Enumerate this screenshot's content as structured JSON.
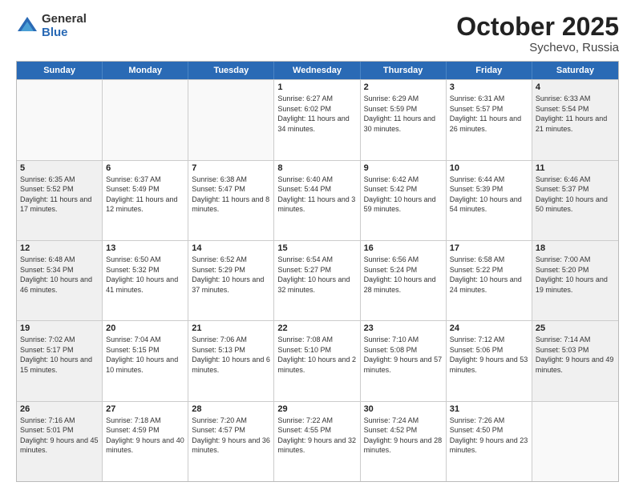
{
  "logo": {
    "general": "General",
    "blue": "Blue"
  },
  "title": {
    "month": "October 2025",
    "location": "Sychevo, Russia"
  },
  "days": [
    "Sunday",
    "Monday",
    "Tuesday",
    "Wednesday",
    "Thursday",
    "Friday",
    "Saturday"
  ],
  "weeks": [
    [
      {
        "day": "",
        "empty": true
      },
      {
        "day": "",
        "empty": true
      },
      {
        "day": "",
        "empty": true
      },
      {
        "day": "1",
        "sunrise": "6:27 AM",
        "sunset": "6:02 PM",
        "daylight": "11 hours and 34 minutes."
      },
      {
        "day": "2",
        "sunrise": "6:29 AM",
        "sunset": "5:59 PM",
        "daylight": "11 hours and 30 minutes."
      },
      {
        "day": "3",
        "sunrise": "6:31 AM",
        "sunset": "5:57 PM",
        "daylight": "11 hours and 26 minutes."
      },
      {
        "day": "4",
        "sunrise": "6:33 AM",
        "sunset": "5:54 PM",
        "daylight": "11 hours and 21 minutes."
      }
    ],
    [
      {
        "day": "5",
        "sunrise": "6:35 AM",
        "sunset": "5:52 PM",
        "daylight": "11 hours and 17 minutes."
      },
      {
        "day": "6",
        "sunrise": "6:37 AM",
        "sunset": "5:49 PM",
        "daylight": "11 hours and 12 minutes."
      },
      {
        "day": "7",
        "sunrise": "6:38 AM",
        "sunset": "5:47 PM",
        "daylight": "11 hours and 8 minutes."
      },
      {
        "day": "8",
        "sunrise": "6:40 AM",
        "sunset": "5:44 PM",
        "daylight": "11 hours and 3 minutes."
      },
      {
        "day": "9",
        "sunrise": "6:42 AM",
        "sunset": "5:42 PM",
        "daylight": "10 hours and 59 minutes."
      },
      {
        "day": "10",
        "sunrise": "6:44 AM",
        "sunset": "5:39 PM",
        "daylight": "10 hours and 54 minutes."
      },
      {
        "day": "11",
        "sunrise": "6:46 AM",
        "sunset": "5:37 PM",
        "daylight": "10 hours and 50 minutes."
      }
    ],
    [
      {
        "day": "12",
        "sunrise": "6:48 AM",
        "sunset": "5:34 PM",
        "daylight": "10 hours and 46 minutes."
      },
      {
        "day": "13",
        "sunrise": "6:50 AM",
        "sunset": "5:32 PM",
        "daylight": "10 hours and 41 minutes."
      },
      {
        "day": "14",
        "sunrise": "6:52 AM",
        "sunset": "5:29 PM",
        "daylight": "10 hours and 37 minutes."
      },
      {
        "day": "15",
        "sunrise": "6:54 AM",
        "sunset": "5:27 PM",
        "daylight": "10 hours and 32 minutes."
      },
      {
        "day": "16",
        "sunrise": "6:56 AM",
        "sunset": "5:24 PM",
        "daylight": "10 hours and 28 minutes."
      },
      {
        "day": "17",
        "sunrise": "6:58 AM",
        "sunset": "5:22 PM",
        "daylight": "10 hours and 24 minutes."
      },
      {
        "day": "18",
        "sunrise": "7:00 AM",
        "sunset": "5:20 PM",
        "daylight": "10 hours and 19 minutes."
      }
    ],
    [
      {
        "day": "19",
        "sunrise": "7:02 AM",
        "sunset": "5:17 PM",
        "daylight": "10 hours and 15 minutes."
      },
      {
        "day": "20",
        "sunrise": "7:04 AM",
        "sunset": "5:15 PM",
        "daylight": "10 hours and 10 minutes."
      },
      {
        "day": "21",
        "sunrise": "7:06 AM",
        "sunset": "5:13 PM",
        "daylight": "10 hours and 6 minutes."
      },
      {
        "day": "22",
        "sunrise": "7:08 AM",
        "sunset": "5:10 PM",
        "daylight": "10 hours and 2 minutes."
      },
      {
        "day": "23",
        "sunrise": "7:10 AM",
        "sunset": "5:08 PM",
        "daylight": "9 hours and 57 minutes."
      },
      {
        "day": "24",
        "sunrise": "7:12 AM",
        "sunset": "5:06 PM",
        "daylight": "9 hours and 53 minutes."
      },
      {
        "day": "25",
        "sunrise": "7:14 AM",
        "sunset": "5:03 PM",
        "daylight": "9 hours and 49 minutes."
      }
    ],
    [
      {
        "day": "26",
        "sunrise": "7:16 AM",
        "sunset": "5:01 PM",
        "daylight": "9 hours and 45 minutes."
      },
      {
        "day": "27",
        "sunrise": "7:18 AM",
        "sunset": "4:59 PM",
        "daylight": "9 hours and 40 minutes."
      },
      {
        "day": "28",
        "sunrise": "7:20 AM",
        "sunset": "4:57 PM",
        "daylight": "9 hours and 36 minutes."
      },
      {
        "day": "29",
        "sunrise": "7:22 AM",
        "sunset": "4:55 PM",
        "daylight": "9 hours and 32 minutes."
      },
      {
        "day": "30",
        "sunrise": "7:24 AM",
        "sunset": "4:52 PM",
        "daylight": "9 hours and 28 minutes."
      },
      {
        "day": "31",
        "sunrise": "7:26 AM",
        "sunset": "4:50 PM",
        "daylight": "9 hours and 23 minutes."
      },
      {
        "day": "",
        "empty": true
      }
    ]
  ]
}
